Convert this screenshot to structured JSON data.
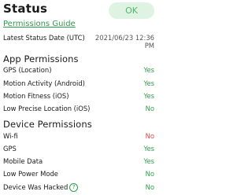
{
  "header": {
    "title": "Status",
    "ok_label": "OK",
    "guide_link": "Permissions Guide"
  },
  "latest": {
    "label": "Latest Status Date (UTC)",
    "value_line1": "2021/06/23 12:36",
    "value_line2": "PM"
  },
  "app_permissions": {
    "heading": "App Permissions",
    "rows": [
      {
        "label": "GPS (Location)",
        "value": "Yes"
      },
      {
        "label": "Motion Activity (Android)",
        "value": "Yes"
      },
      {
        "label": "Motion Fitness (iOS)",
        "value": "Yes"
      },
      {
        "label": "Low Precise Location (iOS)",
        "value": "No"
      }
    ]
  },
  "device_permissions": {
    "heading": "Device Permissions",
    "rows": [
      {
        "label": "Wi-fi",
        "value": "No"
      },
      {
        "label": "GPS",
        "value": "Yes"
      },
      {
        "label": "Mobile Data",
        "value": "Yes"
      },
      {
        "label": "Low Power Mode",
        "value": "No"
      },
      {
        "label": "Device Was Hacked",
        "value": "No",
        "help_icon": "?"
      }
    ]
  },
  "colors": {
    "green": "#2e9e4b",
    "red": "#d84848",
    "ok_bg": "#dff3e3"
  }
}
